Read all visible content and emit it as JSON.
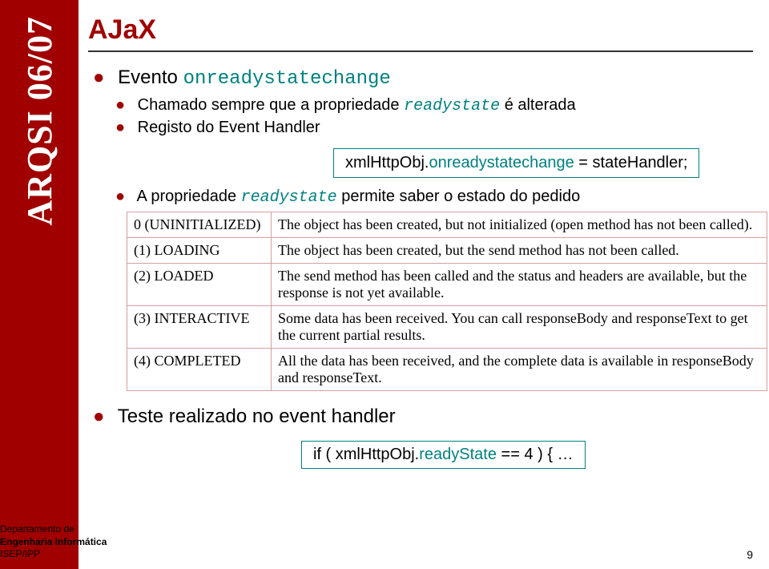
{
  "left_band": "ARQSI 06/07",
  "title": "AJaX",
  "bullets": {
    "evento_label": "Evento",
    "evento_code": "onreadystatechange",
    "sub1": "Chamado sempre que a propriedade",
    "sub1_code": "readystate",
    "sub1_tail": "é alterada",
    "sub2": "Registo do Event Handler",
    "codebox_prefix": "xmlHttpObj.",
    "codebox_mid": "onreadystatechange",
    "codebox_suffix": " = stateHandler;",
    "sub3_a": "A propriedade",
    "sub3_code": "readystate",
    "sub3_b": "permite saber o estado do pedido",
    "teste": "Teste realizado no event handler",
    "footer_code_a": "if ( xmlHttpObj.",
    "footer_code_b": "readyState",
    "footer_code_c": " == 4 ) { …"
  },
  "table": {
    "rows": [
      {
        "state": "0 (UNINITIALIZED)",
        "desc": "The object has been created, but not initialized (open method has not been called)."
      },
      {
        "state": "(1) LOADING",
        "desc": "The object has been created, but the send method has not been called."
      },
      {
        "state": "(2) LOADED",
        "desc": "The send method has been called and the status and headers are available, but the response is not yet available."
      },
      {
        "state": "(3) INTERACTIVE",
        "desc": "Some data has been received. You can call responseBody and responseText to get the current partial results."
      },
      {
        "state": "(4) COMPLETED",
        "desc": "All the data has been received, and the complete data is available in responseBody and responseText."
      }
    ]
  },
  "footer": {
    "dept1": "Departamento de",
    "dept2": "Engenharia Informática",
    "dept3": "ISEP/IPP",
    "page": "9"
  }
}
